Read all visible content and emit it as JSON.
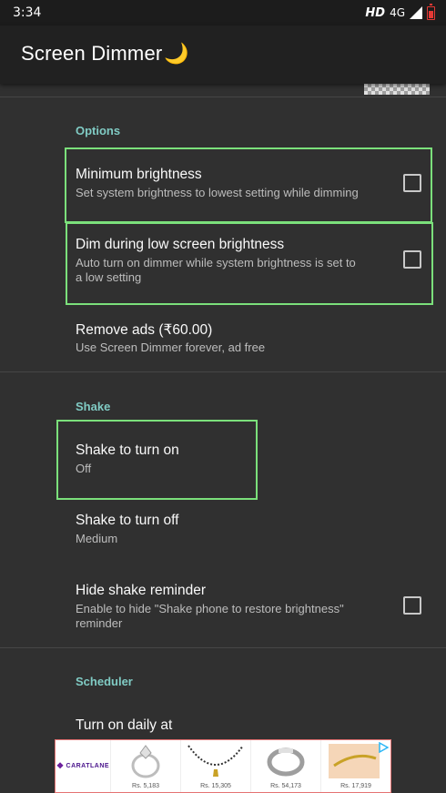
{
  "status_bar": {
    "time": "3:34",
    "hd": "HD",
    "network": "4G"
  },
  "app_bar": {
    "title": "Screen Dimmer",
    "emoji": "🌙"
  },
  "sections": {
    "options": {
      "header": "Options",
      "items": [
        {
          "title": "Minimum brightness",
          "subtitle": "Set system brightness to lowest setting while dimming",
          "checked": false
        },
        {
          "title": "Dim during low screen brightness",
          "subtitle_line1": "Auto turn on dimmer while system brightness is set to",
          "subtitle_line2": "a low setting",
          "checked": false
        },
        {
          "title": "Remove ads (₹60.00)",
          "subtitle": "Use Screen Dimmer forever, ad free"
        }
      ]
    },
    "shake": {
      "header": "Shake",
      "items": [
        {
          "title": "Shake to turn on",
          "subtitle": "Off"
        },
        {
          "title": "Shake to turn off",
          "subtitle": "Medium"
        },
        {
          "title": "Hide shake reminder",
          "subtitle_line1": "Enable to hide \"Shake phone to restore brightness\"",
          "subtitle_line2": "reminder",
          "checked": false
        }
      ]
    },
    "scheduler": {
      "header": "Scheduler",
      "items": [
        {
          "title": "Turn on daily at"
        }
      ]
    }
  },
  "ad": {
    "brand": "CARATLANE",
    "products": [
      {
        "name": "ring-solitaire",
        "price": "Rs. 5,183"
      },
      {
        "name": "mangalsutra",
        "price": "Rs. 15,305"
      },
      {
        "name": "ring-band",
        "price": "Rs. 54,173"
      },
      {
        "name": "bangle",
        "price": "Rs. 17,919"
      }
    ]
  },
  "colors": {
    "accent": "#80cbc4",
    "highlight": "#7be07b",
    "background": "#303030",
    "appbar": "#212121"
  }
}
